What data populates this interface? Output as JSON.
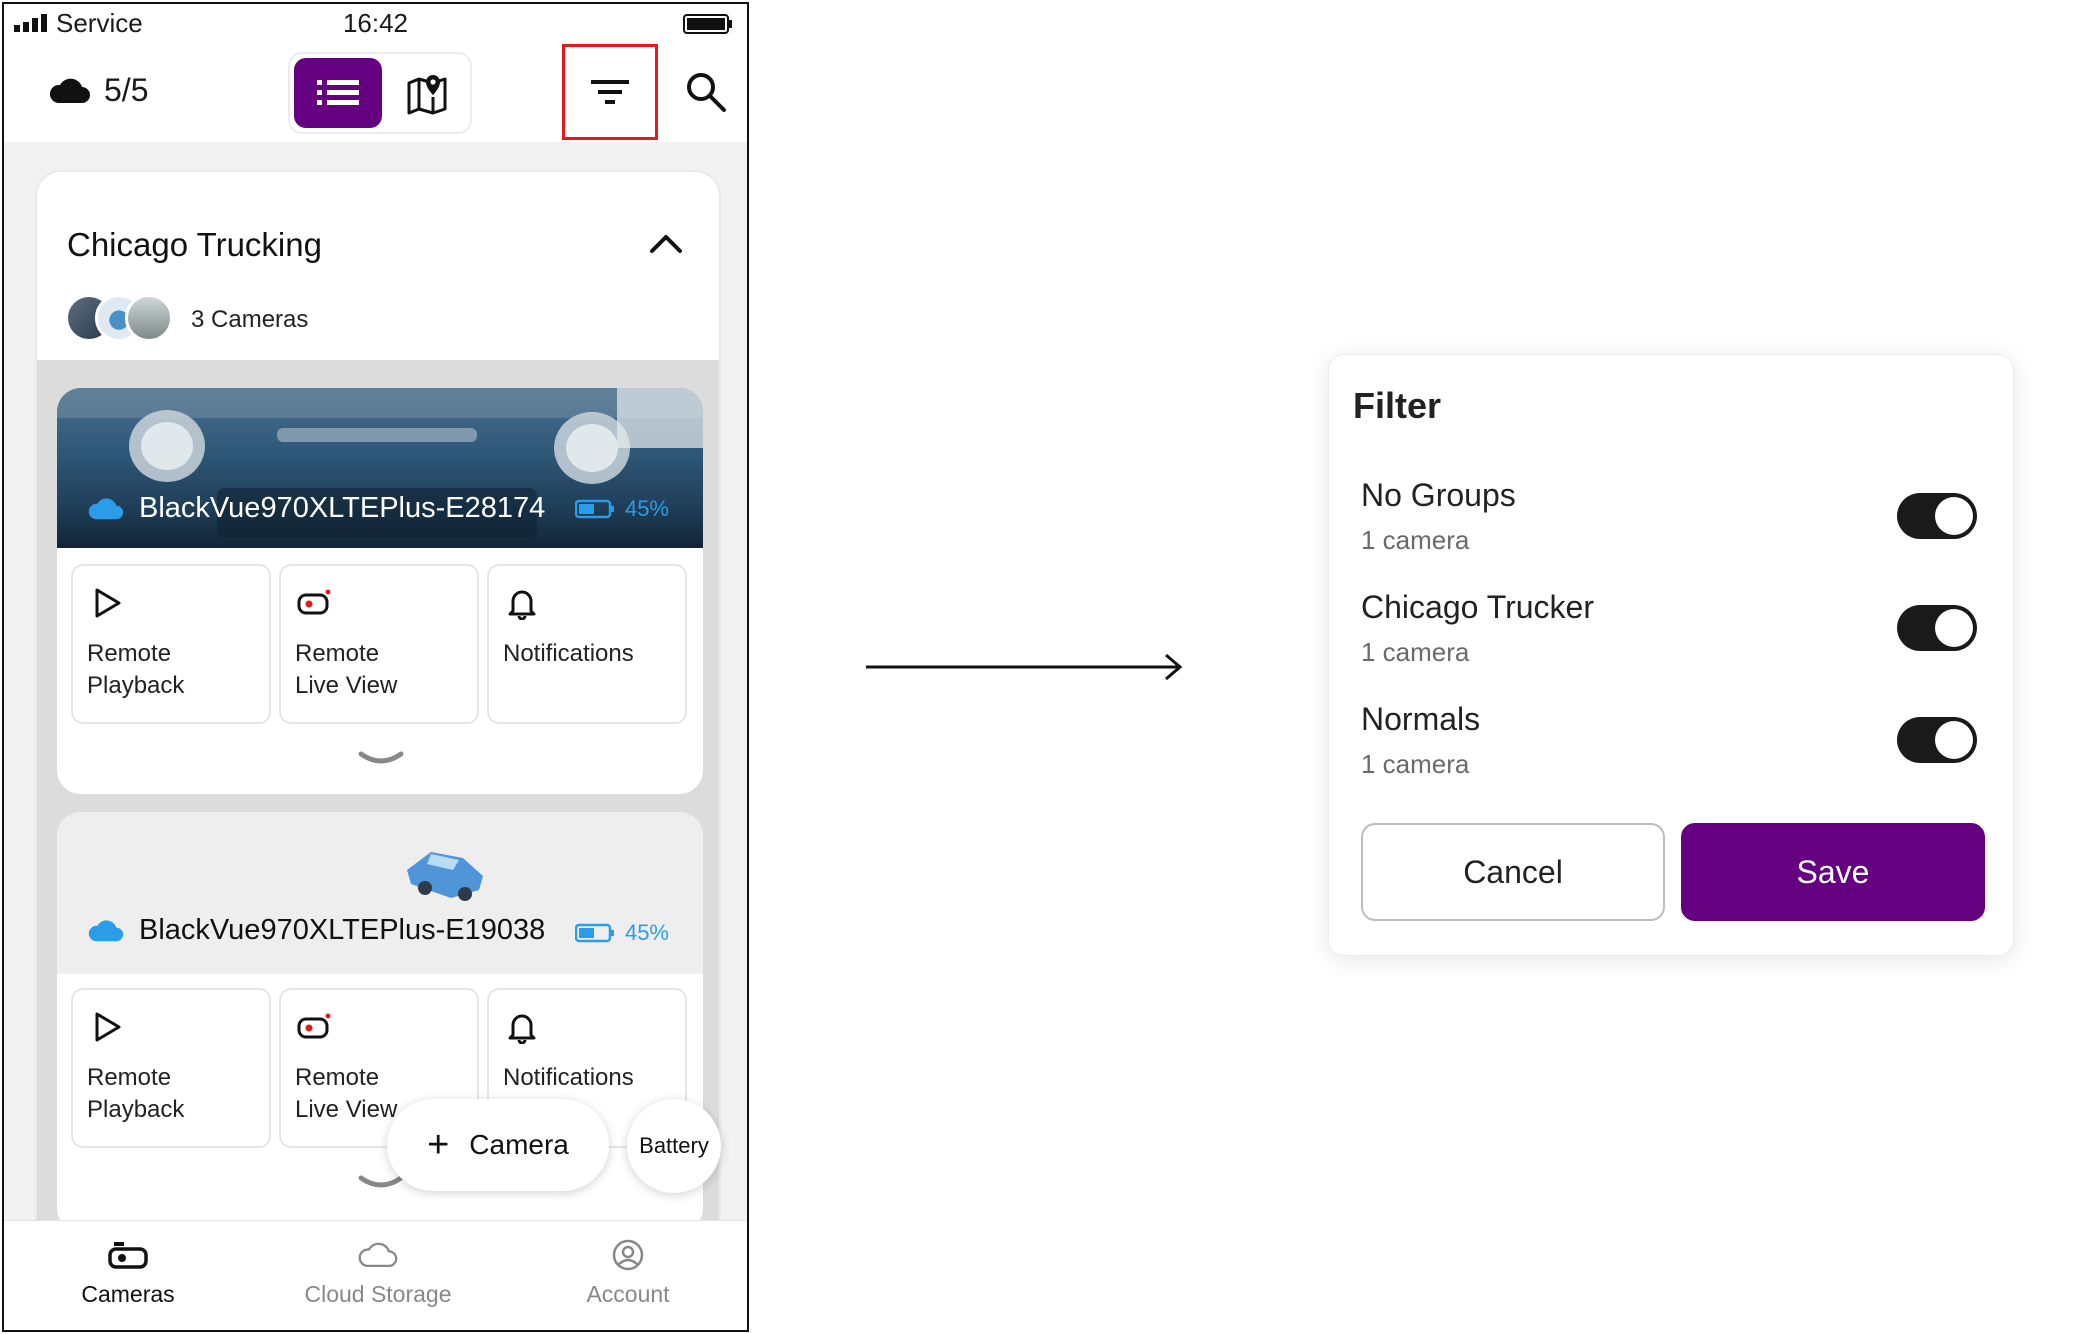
{
  "colors": {
    "brand": "#650080",
    "highlight": "#e51b1b",
    "battery": "#2b9de8",
    "cloud": "#2b9de8"
  },
  "status": {
    "carrier": "Service",
    "time": "16:42"
  },
  "topbar": {
    "cloud_count": "5/5"
  },
  "group": {
    "name": "Chicago Trucking",
    "camera_count": "3 Cameras"
  },
  "cameras": [
    {
      "name": "BlackVue970XLTEPlus-E28174",
      "battery": "45%"
    },
    {
      "name": "BlackVue970XLTEPlus-E19038",
      "battery": "45%"
    }
  ],
  "actions": {
    "playback": "Remote\nPlayback",
    "live": "Remote\nLive View",
    "notifications": "Notifications"
  },
  "fab": {
    "camera": "Camera",
    "battery": "Battery"
  },
  "nav": {
    "cameras": "Cameras",
    "cloud": "Cloud Storage",
    "account": "Account"
  },
  "filter": {
    "title": "Filter",
    "items": [
      {
        "name": "No Groups",
        "count": "1 camera",
        "enabled": true
      },
      {
        "name": "Chicago Trucker",
        "count": "1 camera",
        "enabled": true
      },
      {
        "name": "Normals",
        "count": "1 camera",
        "enabled": true
      }
    ],
    "cancel": "Cancel",
    "save": "Save"
  }
}
